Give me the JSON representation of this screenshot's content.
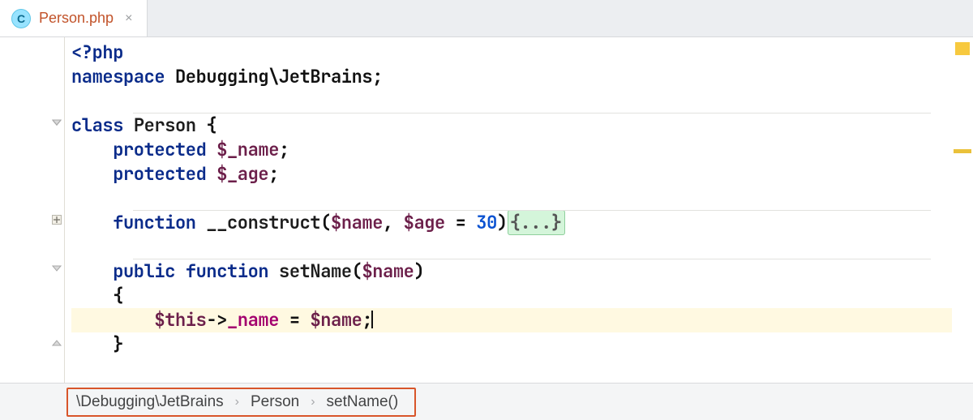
{
  "tab": {
    "badge_letter": "C",
    "filename": "Person.php",
    "close_glyph": "×"
  },
  "code": {
    "open_tag": "<?php",
    "ns_kw": "namespace",
    "ns_name": " Debugging\\JetBrains",
    "class_kw": "class",
    "class_name": " Person ",
    "brace_open": "{",
    "protected_kw": "protected",
    "field_name": " $_name",
    "field_age": " $_age",
    "semicolon": ";",
    "function_kw": "function",
    "ctor_name": " __construct",
    "paren_open": "(",
    "paren_close": ")",
    "param_name": "$name",
    "comma": ", ",
    "param_age": "$age",
    "eq": " = ",
    "default_age": "30",
    "fold_ellipsis": "{...}",
    "public_kw": "public",
    "setter_name": " setName",
    "this_var": "$this",
    "arrow": "->",
    "prop": "_name",
    "brace_close": "}"
  },
  "breadcrumb": {
    "ns": "\\Debugging\\JetBrains",
    "cls": "Person",
    "method": "setName()"
  },
  "markers": {
    "analysis_color": "#f7c93f",
    "warning_color": "#eac13a"
  }
}
